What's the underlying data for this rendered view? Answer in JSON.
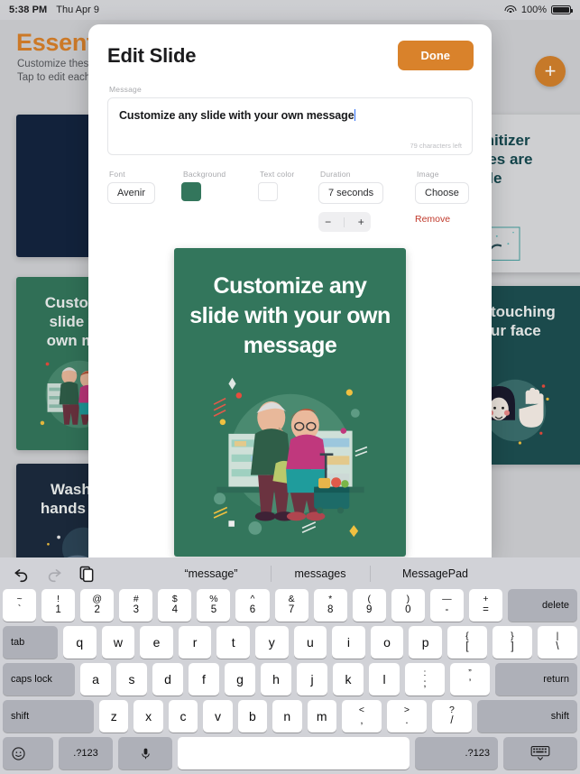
{
  "statusbar": {
    "time": "5:38 PM",
    "date": "Thu Apr 9",
    "battery_pct": "100%",
    "wifi_icon": "wifi-icon",
    "battery_icon": "battery-full-icon"
  },
  "background_app": {
    "title": "Essentia",
    "subtitle_line1": "Customize these",
    "subtitle_line2": "Tap to edit each",
    "add_button_label": "+",
    "cards": [
      {
        "text": "",
        "bg": "#14253f",
        "fg": "#edf1f0",
        "pos": "left-top"
      },
      {
        "text": "-sanitizer\nwipes are\nilable",
        "bg": "#d9dadd",
        "fg": "#15484f",
        "pos": "right-top"
      },
      {
        "text": "Customiz\nslide wit\nown mes",
        "bg": "#33765c",
        "fg": "#edf1f0",
        "pos": "left-mid"
      },
      {
        "text": "touching\nur face",
        "bg": "#1d4f51",
        "fg": "#edf1f0",
        "pos": "right-mid"
      },
      {
        "text": "Wash y\nhands reg",
        "bg": "#1c2b3e",
        "fg": "#edf1f0",
        "pos": "left-bot"
      }
    ]
  },
  "modal": {
    "title": "Edit Slide",
    "done_label": "Done",
    "message": {
      "label": "Message",
      "value": "Customize any slide with your own message",
      "characters_left": "79 characters left"
    },
    "controls": {
      "font": {
        "label": "Font",
        "value": "Avenir"
      },
      "background": {
        "label": "Background",
        "color": "#33765c"
      },
      "text_color": {
        "label": "Text color",
        "color": "#ffffff"
      },
      "duration": {
        "label": "Duration",
        "value": "7 seconds",
        "minus": "−",
        "plus": "+"
      },
      "image": {
        "label": "Image",
        "choose": "Choose",
        "remove": "Remove"
      }
    },
    "preview": {
      "text": "Customize any slide with your own message",
      "bg_color": "#33765c",
      "text_color": "#ffffff",
      "illustration": "elderly-couple-shopping-illustration"
    }
  },
  "keyboard": {
    "toolbar": {
      "undo_icon": "undo-icon",
      "redo_icon": "redo-icon",
      "paste_icon": "paste-icon"
    },
    "predictions": [
      "“message”",
      "messages",
      "MessagePad"
    ],
    "row_numbers": [
      {
        "sup": "~",
        "sub": "`"
      },
      {
        "sup": "!",
        "sub": "1"
      },
      {
        "sup": "@",
        "sub": "2"
      },
      {
        "sup": "#",
        "sub": "3"
      },
      {
        "sup": "$",
        "sub": "4"
      },
      {
        "sup": "%",
        "sub": "5"
      },
      {
        "sup": "^",
        "sub": "6"
      },
      {
        "sup": "&",
        "sub": "7"
      },
      {
        "sup": "*",
        "sub": "8"
      },
      {
        "sup": "(",
        "sub": "9"
      },
      {
        "sup": ")",
        "sub": "0"
      },
      {
        "sup": "—",
        "sub": "-"
      },
      {
        "sup": "+",
        "sub": "="
      }
    ],
    "delete_label": "delete",
    "row_top": [
      "q",
      "w",
      "e",
      "r",
      "t",
      "y",
      "u",
      "i",
      "o",
      "p"
    ],
    "row_top_extra": [
      {
        "sup": "{",
        "sub": "["
      },
      {
        "sup": "}",
        "sub": "]"
      },
      {
        "sup": "|",
        "sub": "\\"
      }
    ],
    "tab_label": "tab",
    "row_home": [
      "a",
      "s",
      "d",
      "f",
      "g",
      "h",
      "j",
      "k",
      "l"
    ],
    "row_home_extra": [
      {
        "sup": ":",
        "sub": ";"
      },
      {
        "sup": "”",
        "sub": "’"
      }
    ],
    "caps_label": "caps lock",
    "return_label": "return",
    "row_bottom": [
      "z",
      "x",
      "c",
      "v",
      "b",
      "n",
      "m"
    ],
    "row_bottom_extra": [
      {
        "sup": "<",
        "sub": ","
      },
      {
        "sup": ">",
        "sub": "."
      },
      {
        "sup": "?",
        "sub": "/"
      }
    ],
    "shift_left_label": "shift",
    "shift_right_label": "shift",
    "bottom_row": {
      "emoji_icon": "emoji-smiley-icon",
      "numeric_left": ".?123",
      "mic_icon": "microphone-icon",
      "space_label": "",
      "numeric_right": ".?123",
      "dismiss_icon": "hide-keyboard-icon"
    }
  }
}
